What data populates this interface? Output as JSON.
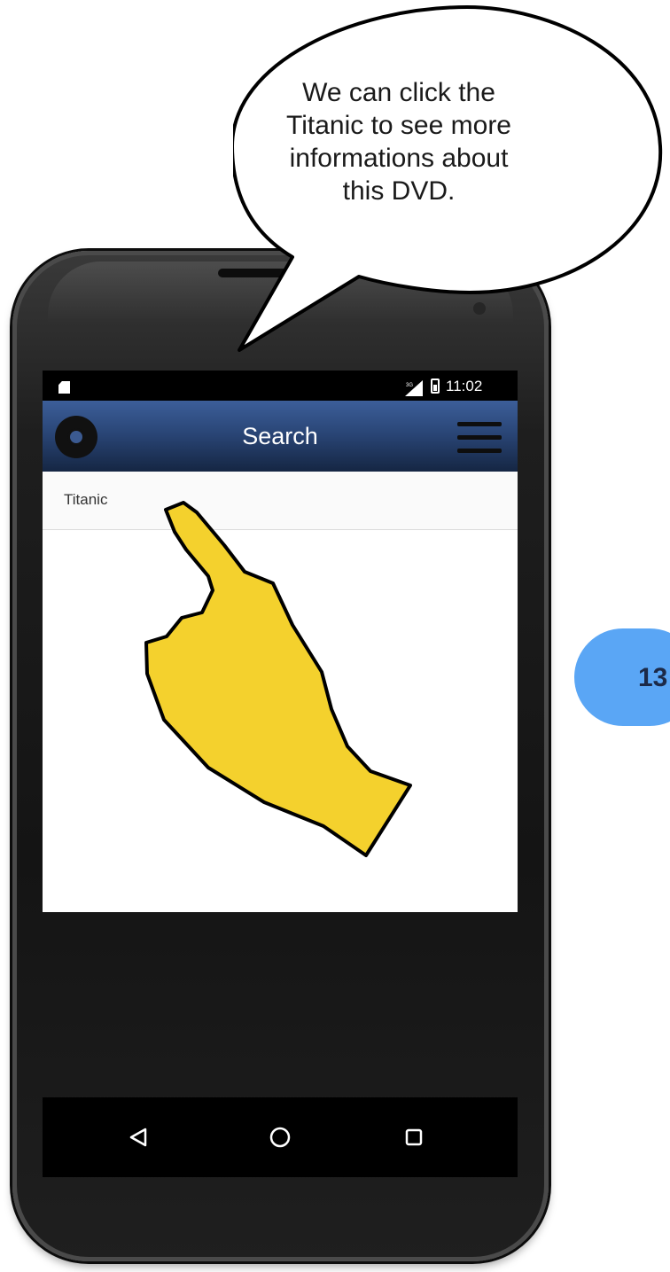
{
  "callout": {
    "text": "We can click the Titanic to see more informations about this DVD."
  },
  "status_bar": {
    "time": "11:02"
  },
  "app_bar": {
    "title": "Search"
  },
  "results": [
    {
      "label": "Titanic"
    }
  ],
  "page_badge": {
    "number": "13"
  },
  "colors": {
    "app_bar": "#2a4677",
    "hand_fill": "#f4d12d",
    "badge": "#5aa6f5"
  }
}
